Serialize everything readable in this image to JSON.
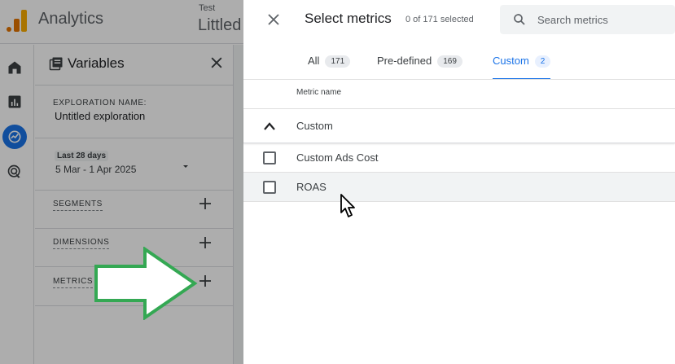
{
  "app": {
    "title": "Analytics",
    "account_small": "Test",
    "account_big": "Littled"
  },
  "rail": {
    "items": [
      "home-icon",
      "reports-icon",
      "explore-icon",
      "advertising-icon"
    ],
    "active": "explore-icon"
  },
  "variables": {
    "title": "Variables",
    "exploration_label": "EXPLORATION NAME:",
    "exploration_name": "Untitled exploration",
    "date_label": "Last 28 days",
    "date_range": "5 Mar - 1 Apr 2025",
    "sections": [
      {
        "label": "SEGMENTS"
      },
      {
        "label": "DIMENSIONS"
      },
      {
        "label": "METRICS"
      }
    ]
  },
  "drawer": {
    "title": "Select metrics",
    "selected_count": "0 of 171 selected",
    "search_placeholder": "Search metrics",
    "tabs": [
      {
        "label": "All",
        "count": "171"
      },
      {
        "label": "Pre-defined",
        "count": "169"
      },
      {
        "label": "Custom",
        "count": "2"
      }
    ],
    "active_tab": "Custom",
    "column_header": "Metric name",
    "group_label": "Custom",
    "metrics": [
      {
        "label": "Custom Ads Cost",
        "checked": false
      },
      {
        "label": "ROAS",
        "checked": false
      }
    ]
  },
  "colors": {
    "accent": "#1a73e8",
    "arrow_outline": "#34a853",
    "arrow_fill": "#ffffff"
  }
}
